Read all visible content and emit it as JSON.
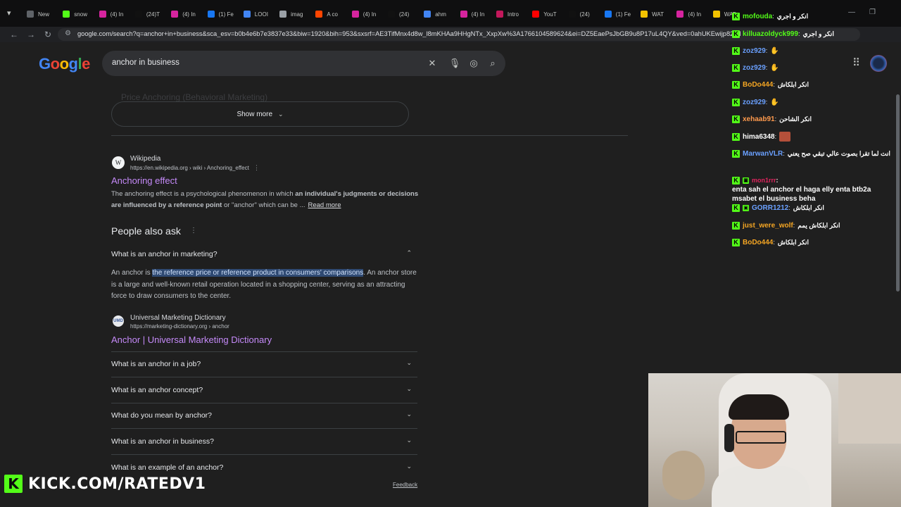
{
  "browser": {
    "tabs": [
      {
        "label": "New",
        "color": "#5f6368",
        "icon": "new-tab-icon"
      },
      {
        "label": "snow",
        "color": "#53fc18",
        "icon": "kick-icon"
      },
      {
        "label": "(4) In",
        "color": "#d6249f",
        "icon": "instagram-icon"
      },
      {
        "label": "(24)T",
        "color": "#111111",
        "icon": "tiktok-icon"
      },
      {
        "label": "(4) In",
        "color": "#d6249f",
        "icon": "instagram-icon"
      },
      {
        "label": "(1) Fe",
        "color": "#1877f2",
        "icon": "facebook-icon"
      },
      {
        "label": "LOOI",
        "color": "#4285f4",
        "icon": "google-icon"
      },
      {
        "label": "imag",
        "color": "#9aa0a6",
        "icon": "image-search-icon"
      },
      {
        "label": "A co",
        "color": "#ff4500",
        "icon": "reddit-icon"
      },
      {
        "label": "(4) In",
        "color": "#d6249f",
        "icon": "instagram-icon"
      },
      {
        "label": "(24)",
        "color": "#111111",
        "icon": "tiktok-icon"
      },
      {
        "label": "ahm",
        "color": "#4285f4",
        "icon": "google-icon"
      },
      {
        "label": "(4) In",
        "color": "#d6249f",
        "icon": "instagram-icon"
      },
      {
        "label": "Intro",
        "color": "#c2185b",
        "icon": "site-icon"
      },
      {
        "label": "YouT",
        "color": "#ff0000",
        "icon": "youtube-icon"
      },
      {
        "label": "(24)",
        "color": "#111111",
        "icon": "tiktok-icon"
      },
      {
        "label": "(1) Fe",
        "color": "#1877f2",
        "icon": "facebook-icon"
      },
      {
        "label": "WAT",
        "color": "#f2c200",
        "icon": "watch-icon"
      },
      {
        "label": "(4) In",
        "color": "#d6249f",
        "icon": "instagram-icon"
      },
      {
        "label": "WAT",
        "color": "#f2c200",
        "icon": "watch-icon"
      }
    ],
    "url": "google.com/search?q=anchor+in+business&sca_esv=b0b4e6b7e3837e33&biw=1920&bih=953&sxsrf=AE3TifMnx4d8w_l8mKHAa9HHgNTx_XxpXw%3A1766104589624&ei=DZ5EaePsJbGB9u8P17uL4QY&ved=0ahUKEwijp82tM"
  },
  "google": {
    "logo": [
      "G",
      "o",
      "o",
      "g",
      "l",
      "e"
    ],
    "logo_colors": [
      "#4285f4",
      "#ea4335",
      "#fbbc05",
      "#4285f4",
      "#34a853",
      "#ea4335"
    ],
    "search_query": "anchor in business"
  },
  "results": {
    "faded_text": "Price Anchoring (Behavioral Marketing)",
    "show_more": "Show more",
    "wikipedia": {
      "favicon": "W",
      "site": "Wikipedia",
      "url": "https://en.wikipedia.org › wiki › Anchoring_effect",
      "title": "Anchoring effect",
      "snippet_1": "The anchoring effect is a psychological phenomenon in which ",
      "snippet_bold": "an individual's judgments or decisions are influenced by a reference point",
      "snippet_2": " or \"anchor\" which can be ...",
      "read_more": "Read more"
    },
    "paa": {
      "title": "People also ask",
      "expanded_question": "What is an anchor in marketing?",
      "answer_pre": "An anchor is ",
      "answer_highlight": "the reference price or reference product in consumers' comparisons",
      "answer_post": ". An anchor store is a large and well-known retail operation located in a shopping center, serving as an attracting force to draw consumers to the center.",
      "source": {
        "favicon": "UMD",
        "site": "Universal Marketing Dictionary",
        "url": "https://marketing-dictionary.org › anchor",
        "title": "Anchor | Universal Marketing Dictionary"
      },
      "questions": [
        "What is an anchor in a job?",
        "What is an anchor concept?",
        "What do you mean by anchor?",
        "What is an anchor in business?",
        "What is an example of an anchor?"
      ]
    },
    "feedback": "Feedback"
  },
  "chat": {
    "messages": [
      {
        "user": "mofouda",
        "color": "#53fc18",
        "text": "انكر و اجري"
      },
      {
        "user": "killuazoldyck999",
        "color": "#53fc18",
        "text": "انكر و اجري"
      },
      {
        "user": "zoz929",
        "color": "#6aa0ff",
        "text": ""
      },
      {
        "user": "zoz929",
        "color": "#6aa0ff",
        "text": ""
      },
      {
        "user": "BoDo444",
        "color": "#f5a623",
        "text": "انكر ابلكاش"
      },
      {
        "user": "zoz929",
        "color": "#6aa0ff",
        "text": ""
      },
      {
        "user": "xehaab91",
        "color": "#ff9a4d",
        "text": "انكر الشاحن"
      },
      {
        "user": "hima6348",
        "color": "#ffffff",
        "text": ""
      },
      {
        "user": "MarwanVLR",
        "color": "#6aa0ff",
        "text": "انت لما تقرا بصوت عالي تبقي صح يعني"
      },
      {
        "user": "GORR1212",
        "color": "#6aa0ff",
        "text": "انكر ابلكاش"
      },
      {
        "user": "just_were_wolf",
        "color": "#f5a623",
        "text": "انكر ابلكاش يمم"
      },
      {
        "user": "BoDo444",
        "color": "#f5a623",
        "text": "انكر ابلكاش"
      }
    ],
    "multiline": {
      "user": "mon1rrr",
      "color": "#e0245e",
      "text": "enta sah el anchor el haga elly enta btb2a msabet el business beha"
    }
  },
  "overlay": {
    "kick_logo": "K",
    "kick_text": "KICK.COM/RATEDV1"
  }
}
